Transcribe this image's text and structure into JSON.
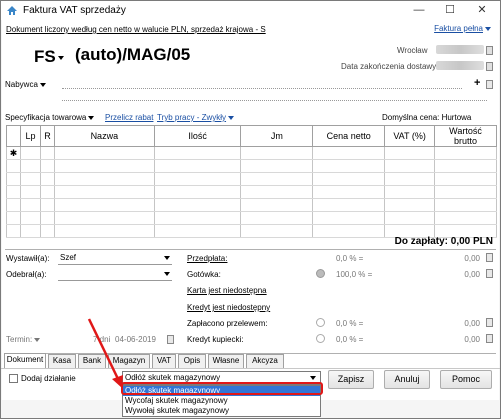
{
  "window": {
    "title": "Faktura VAT sprzedaży",
    "minimize": "—",
    "maximize": "☐",
    "close": "✕"
  },
  "header": {
    "info_line": "Dokument liczony według cen netto w walucie PLN, sprzedaż krajowa - S",
    "faktura_pelna": "Faktura pełna",
    "doc_type": "FS",
    "doc_number": "(auto)/MAG/05",
    "wroclaw_label": "Wrocław",
    "data_zakonczenia_label": "Data zakończenia dostawy",
    "nabywca_label": "Nabywca",
    "plus": "+"
  },
  "toolbar": {
    "specyfikacja": "Specyfikacja towarowa",
    "przelicz_rabat": "Przelicz rabat",
    "tryb_pracy": "Tryb pracy - Zwykły",
    "domyslna_cena": "Domyślna cena: Hurtowa"
  },
  "table": {
    "columns": [
      "Lp",
      "R",
      "Nazwa",
      "Ilość",
      "Jm",
      "Cena netto",
      "VAT (%)",
      "Wartość brutto"
    ],
    "new_row_marker": "✱"
  },
  "total": {
    "label": "Do zapłaty: 0,00 PLN"
  },
  "left_fields": {
    "wystawil_label": "Wystawił(a):",
    "wystawil_value": "Szef",
    "odebral_label": "Odebrał(a):",
    "odebral_value": "",
    "termin_label": "Termin:",
    "termin_days": "7 dni",
    "termin_date": "04-06-2019"
  },
  "payments": {
    "przedplata": {
      "label": "Przedpłata:",
      "pct": "0,0 % =",
      "amount": "0,00"
    },
    "gotowka": {
      "label": "Gotówka:",
      "pct": "100,0 % =",
      "amount": "0,00"
    },
    "karta": {
      "label": "Karta jest niedostępna"
    },
    "kredyt": {
      "label": "Kredyt jest niedostępny"
    },
    "zaplacono": {
      "label": "Zapłacono przelewem:",
      "pct": "0,0 % =",
      "amount": "0,00"
    },
    "kredyt_kupiecki": {
      "label": "Kredyt kupiecki:",
      "pct": "0,0 % =",
      "amount": "0,00"
    }
  },
  "tabs": [
    "Dokument",
    "Kasa",
    "Bank",
    "Magazyn",
    "VAT",
    "Opis",
    "Własne",
    "Akcyza"
  ],
  "bottom": {
    "dodaj_dzialanie": "Dodaj działanie",
    "action_select_value": "Odłóż skutek magazynowy",
    "action_options": [
      "Odłóż skutek magazynowy",
      "Wycofaj skutek magazynowy",
      "Wywołaj skutek magazynowy"
    ],
    "zapisz": "Zapisz",
    "anuluj": "Anuluj",
    "pomoc": "Pomoc"
  },
  "colors": {
    "link": "#1a4fa3",
    "highlight": "#e01818",
    "selection": "#3276d6"
  }
}
